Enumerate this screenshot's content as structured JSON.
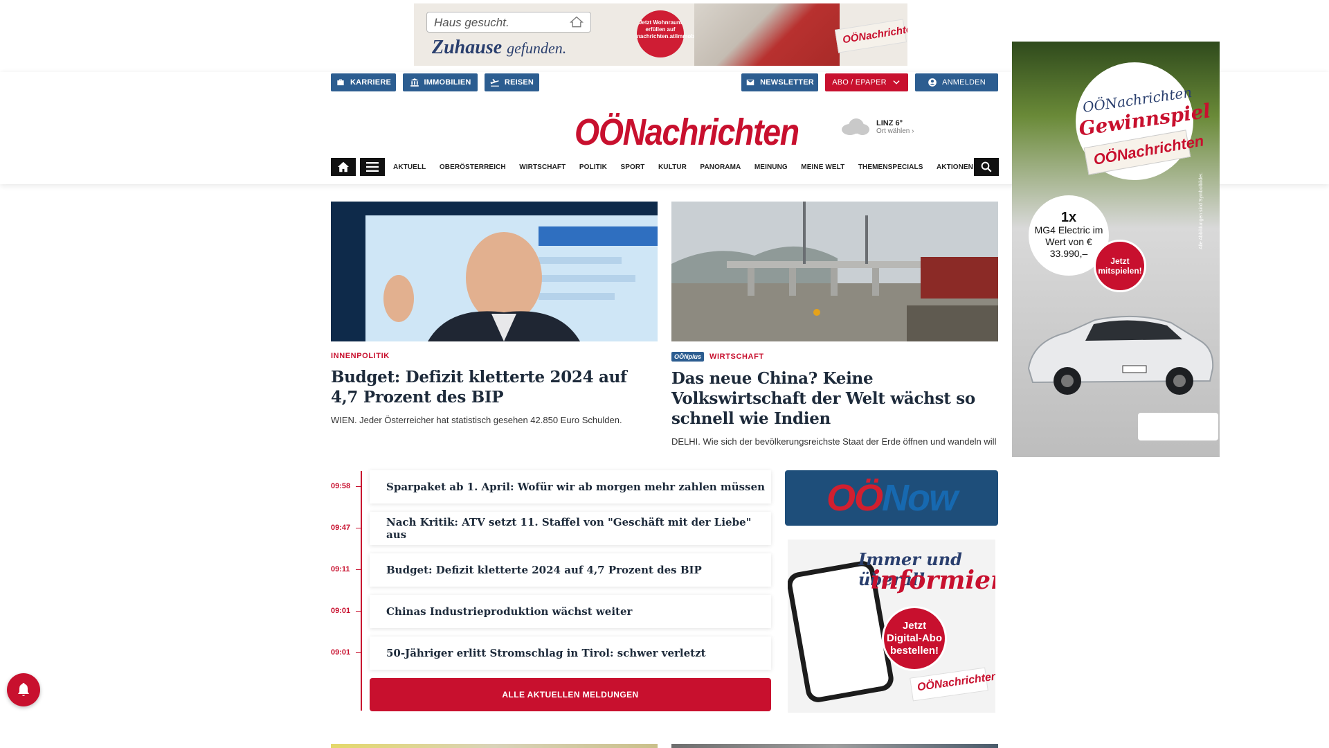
{
  "top_ad": {
    "search_text": "Haus gesucht.",
    "slogan_main": "Zuhause",
    "slogan_small": "gefunden.",
    "badge": "Jetzt Wohnraum erfüllen auf nachrichten.at/immobilien",
    "brand": "OÖNachrichten"
  },
  "service_nav": {
    "karriere": "KARRIERE",
    "immobilien": "IMMOBILIEN",
    "reisen": "REISEN",
    "newsletter": "NEWSLETTER",
    "abo": "ABO / EPAPER",
    "anmelden": "ANMELDEN"
  },
  "logo": "OÖNachrichten",
  "weather": {
    "city": "LINZ 6°",
    "choose": "Ort wählen"
  },
  "main_nav": {
    "items": [
      "AKTUELL",
      "OBERÖSTERREICH",
      "WIRTSCHAFT",
      "POLITIK",
      "SPORT",
      "KULTUR",
      "PANORAMA",
      "MEINUNG",
      "MEINE WELT",
      "THEMENSPECIALS",
      "AKTIONEN"
    ]
  },
  "teasers": [
    {
      "category": "INNENPOLITIK",
      "headline": "Budget: Defizit kletterte 2024 auf 4,7 Prozent des BIP",
      "lead": "WIEN. Jeder Österreicher hat statistisch gesehen 42.850 Euro Schulden."
    },
    {
      "plus_badge": "OÖNplus",
      "category": "WIRTSCHAFT",
      "headline": "Das neue China? Keine Volkswirtschaft der Welt wächst so schnell wie Indien",
      "lead": "DELHI. Wie sich der bevölkerungsreichste Staat der Erde öffnen und wandeln will"
    }
  ],
  "ticker": [
    {
      "time": "09:58",
      "title": "Sparpaket ab 1. April: Wofür wir ab morgen mehr zahlen müssen"
    },
    {
      "time": "09:47",
      "title": "Nach Kritik: ATV setzt 11. Staffel von \"Geschäft mit der Liebe\" aus"
    },
    {
      "time": "09:11",
      "title": "Budget: Defizit kletterte 2024 auf 4,7 Prozent des BIP"
    },
    {
      "time": "09:01",
      "title": "Chinas Industrieproduktion wächst weiter"
    },
    {
      "time": "09:01",
      "title": "50-Jähriger erlitt Stromschlag in Tirol: schwer verletzt"
    }
  ],
  "all_news_button": "ALLE AKTUELLEN MELDUNGEN",
  "oonow": {
    "o": "OÖ",
    "now": "Now"
  },
  "abo_ad": {
    "line1": "Immer und überall",
    "line2": "informiert.",
    "seal": "Jetzt Digital-Abo bestellen!",
    "brand": "OÖNachrichten"
  },
  "side_ad": {
    "line1": "OÖNachrichten",
    "line2": "Gewinnspiel",
    "brand": "OÖNachrichten",
    "prize_count": "1x",
    "prize_text": "MG4 Electric im Wert von € 33.990,–",
    "cta": "Jetzt mitspielen!",
    "disclaimer": "Alle Abbildungen sind Symbolbilder."
  },
  "colors": {
    "brand_red": "#c8102e",
    "service_blue": "#2c5d90",
    "headline_dark": "#1d2a3a"
  }
}
